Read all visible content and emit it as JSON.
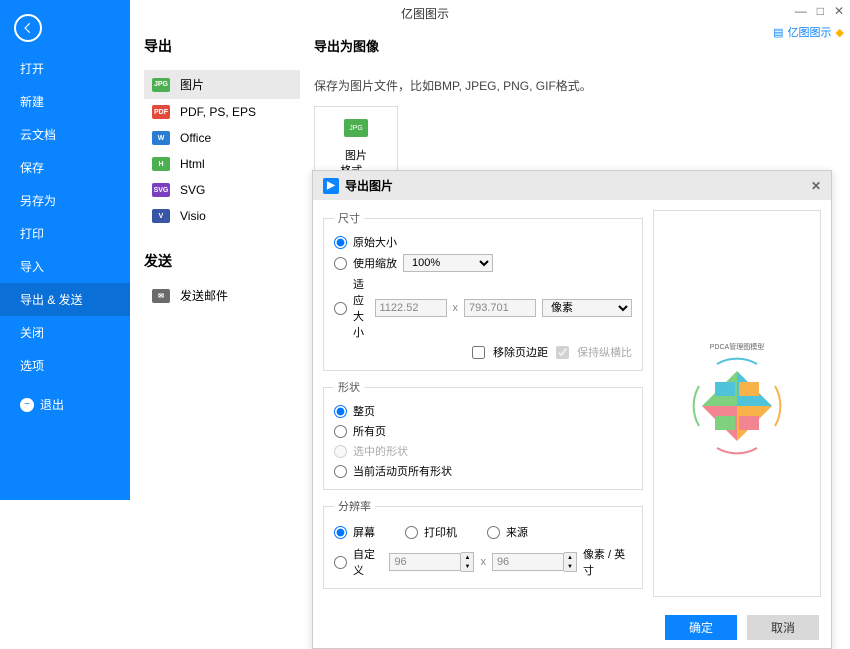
{
  "title": "亿图图示",
  "brand": {
    "text": "亿图图示"
  },
  "sidebar": {
    "items": [
      "打开",
      "新建",
      "云文档",
      "保存",
      "另存为",
      "打印",
      "导入",
      "导出 & 发送",
      "关闭",
      "选项"
    ],
    "exit": "退出",
    "active_index": 7
  },
  "export": {
    "label": "导出",
    "items": [
      {
        "label": "图片",
        "icon": "JPG",
        "cls": "jpg"
      },
      {
        "label": "PDF, PS, EPS",
        "icon": "PDF",
        "cls": "pdf"
      },
      {
        "label": "Office",
        "icon": "W",
        "cls": "off"
      },
      {
        "label": "Html",
        "icon": "H",
        "cls": "htm"
      },
      {
        "label": "SVG",
        "icon": "SVG",
        "cls": "svg"
      },
      {
        "label": "Visio",
        "icon": "V",
        "cls": "vis"
      }
    ],
    "send_label": "发送",
    "send_mail": "发送邮件"
  },
  "detail": {
    "heading": "导出为图像",
    "desc": "保存为图片文件，比如BMP, JPEG, PNG, GIF格式。",
    "tile": {
      "icon": "JPG",
      "line1": "图片",
      "line2": "格式..."
    }
  },
  "dialog": {
    "title": "导出图片",
    "size": {
      "legend": "尺寸",
      "original": "原始大小",
      "use_scale": "使用缩放",
      "scale_value": "100%",
      "fit": "适应大小",
      "width": "1122.52",
      "height": "793.701",
      "unit": "像素",
      "remove_margin": "移除页边距",
      "keep_ratio": "保持纵横比"
    },
    "shape": {
      "legend": "形状",
      "full": "整页",
      "all": "所有页",
      "selected": "选中的形状",
      "current": "当前活动页所有形状"
    },
    "res": {
      "legend": "分辨率",
      "screen": "屏幕",
      "printer": "打印机",
      "source": "来源",
      "custom": "自定义",
      "val1": "96",
      "val2": "96",
      "unit": "像素 / 英寸"
    },
    "preview_title": "PDCA管理图模型",
    "ok": "确定",
    "cancel": "取消"
  }
}
